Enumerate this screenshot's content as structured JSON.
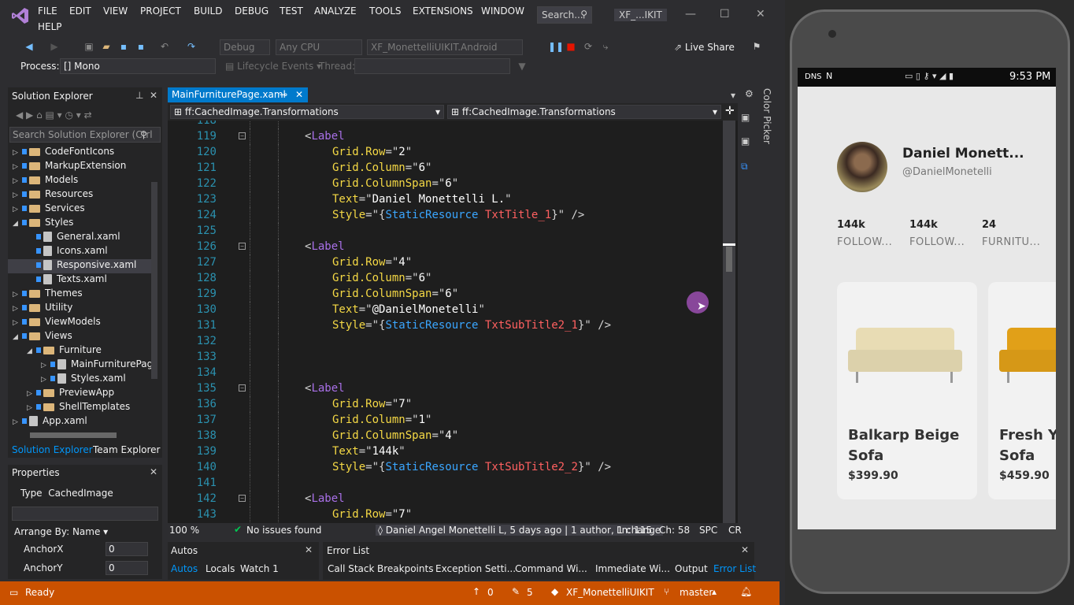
{
  "menubar": {
    "items": [
      "FILE",
      "EDIT",
      "VIEW",
      "PROJECT",
      "BUILD",
      "DEBUG",
      "TEST",
      "ANALYZE",
      "TOOLS",
      "EXTENSIONS",
      "WINDOW",
      "HELP"
    ],
    "search_placeholder": "Search...",
    "window_title": "XF_...IKIT"
  },
  "toolbar": {
    "config": "Debug",
    "platform": "Any CPU",
    "startup": "XF_MonettelliUIKIT.Android",
    "live_share": "Live Share",
    "process_label": "Process:",
    "process_value": "[] Mono",
    "lifecycle": "Lifecycle Events",
    "thread_label": "Thread:"
  },
  "solution_explorer": {
    "title": "Solution Explorer",
    "search_placeholder": "Search Solution Explorer (Ctrl",
    "items": [
      {
        "label": "CodeFontIcons",
        "kind": "folder",
        "indent": 0,
        "arrow": "▷"
      },
      {
        "label": "MarkupExtension",
        "kind": "folder",
        "indent": 0,
        "arrow": "▷"
      },
      {
        "label": "Models",
        "kind": "folder",
        "indent": 0,
        "arrow": "▷"
      },
      {
        "label": "Resources",
        "kind": "folder",
        "indent": 0,
        "arrow": "▷"
      },
      {
        "label": "Services",
        "kind": "folder",
        "indent": 0,
        "arrow": "▷"
      },
      {
        "label": "Styles",
        "kind": "folder",
        "indent": 0,
        "arrow": "◢"
      },
      {
        "label": "General.xaml",
        "kind": "file",
        "indent": 1,
        "arrow": ""
      },
      {
        "label": "Icons.xaml",
        "kind": "file",
        "indent": 1,
        "arrow": ""
      },
      {
        "label": "Responsive.xaml",
        "kind": "file",
        "indent": 1,
        "arrow": "",
        "selected": true
      },
      {
        "label": "Texts.xaml",
        "kind": "file",
        "indent": 1,
        "arrow": ""
      },
      {
        "label": "Themes",
        "kind": "folder",
        "indent": 0,
        "arrow": "▷"
      },
      {
        "label": "Utility",
        "kind": "folder",
        "indent": 0,
        "arrow": "▷"
      },
      {
        "label": "ViewModels",
        "kind": "folder",
        "indent": 0,
        "arrow": "▷"
      },
      {
        "label": "Views",
        "kind": "folder",
        "indent": 0,
        "arrow": "◢"
      },
      {
        "label": "Furniture",
        "kind": "folder",
        "indent": 1,
        "arrow": "◢"
      },
      {
        "label": "MainFurniturePag",
        "kind": "file",
        "indent": 2,
        "arrow": "▷"
      },
      {
        "label": "Styles.xaml",
        "kind": "file",
        "indent": 2,
        "arrow": "▷"
      },
      {
        "label": "PreviewApp",
        "kind": "folder",
        "indent": 1,
        "arrow": "▷"
      },
      {
        "label": "ShellTemplates",
        "kind": "folder",
        "indent": 1,
        "arrow": "▷"
      },
      {
        "label": "App.xaml",
        "kind": "file",
        "indent": 0,
        "arrow": "▷"
      }
    ],
    "tab_active": "Solution Explorer",
    "tab_other": "Team Explorer"
  },
  "properties": {
    "title": "Properties",
    "type_label": "Type",
    "type_value": "CachedImage",
    "arrange_by": "Arrange By: Name",
    "rows": [
      {
        "name": "AnchorX",
        "value": "0"
      },
      {
        "name": "AnchorY",
        "value": "0"
      }
    ]
  },
  "editor": {
    "tab": "MainFurniturePage.xaml",
    "nav_left": "ff:CachedImage.Transformations",
    "nav_right": "ff:CachedImage.Transformations",
    "side_label": "Color Picker",
    "lines": [
      {
        "n": "118",
        "p": []
      },
      {
        "n": "119",
        "p": [
          [
            "<",
            "punc",
            0
          ],
          [
            "Label",
            "tag",
            0
          ]
        ]
      },
      {
        "n": "120",
        "p": [
          [
            "Grid.Row",
            "attr",
            1
          ],
          [
            "=\"",
            "punc",
            0
          ],
          [
            "2",
            "val",
            0
          ],
          [
            "\"",
            "punc",
            0
          ]
        ]
      },
      {
        "n": "121",
        "p": [
          [
            "Grid.Column",
            "attr",
            1
          ],
          [
            "=\"",
            "punc",
            0
          ],
          [
            "6",
            "val",
            0
          ],
          [
            "\"",
            "punc",
            0
          ]
        ]
      },
      {
        "n": "122",
        "p": [
          [
            "Grid.ColumnSpan",
            "attr",
            1
          ],
          [
            "=\"",
            "punc",
            0
          ],
          [
            "6",
            "val",
            0
          ],
          [
            "\"",
            "punc",
            0
          ]
        ]
      },
      {
        "n": "123",
        "p": [
          [
            "Text",
            "attr",
            1
          ],
          [
            "=\"",
            "punc",
            0
          ],
          [
            "Daniel Monettelli L.",
            "val",
            0
          ],
          [
            "\"",
            "punc",
            0
          ]
        ]
      },
      {
        "n": "124",
        "p": [
          [
            "Style",
            "attr",
            1
          ],
          [
            "=\"{",
            "punc",
            0
          ],
          [
            "StaticResource",
            "res",
            0
          ],
          [
            " ",
            "punc",
            0
          ],
          [
            "TxtTitle_1",
            "key",
            0
          ],
          [
            "}\" />",
            "punc",
            0
          ]
        ]
      },
      {
        "n": "125",
        "p": []
      },
      {
        "n": "126",
        "p": [
          [
            "<",
            "punc",
            0
          ],
          [
            "Label",
            "tag",
            0
          ]
        ]
      },
      {
        "n": "127",
        "p": [
          [
            "Grid.Row",
            "attr",
            1
          ],
          [
            "=\"",
            "punc",
            0
          ],
          [
            "4",
            "val",
            0
          ],
          [
            "\"",
            "punc",
            0
          ]
        ]
      },
      {
        "n": "128",
        "p": [
          [
            "Grid.Column",
            "attr",
            1
          ],
          [
            "=\"",
            "punc",
            0
          ],
          [
            "6",
            "val",
            0
          ],
          [
            "\"",
            "punc",
            0
          ]
        ]
      },
      {
        "n": "129",
        "p": [
          [
            "Grid.ColumnSpan",
            "attr",
            1
          ],
          [
            "=\"",
            "punc",
            0
          ],
          [
            "6",
            "val",
            0
          ],
          [
            "\"",
            "punc",
            0
          ]
        ]
      },
      {
        "n": "130",
        "p": [
          [
            "Text",
            "attr",
            1
          ],
          [
            "=\"",
            "punc",
            0
          ],
          [
            "@DanielMonetelli",
            "val",
            0
          ],
          [
            "\"",
            "punc",
            0
          ]
        ]
      },
      {
        "n": "131",
        "p": [
          [
            "Style",
            "attr",
            1
          ],
          [
            "=\"{",
            "punc",
            0
          ],
          [
            "StaticResource",
            "res",
            0
          ],
          [
            " ",
            "punc",
            0
          ],
          [
            "TxtSubTitle2_1",
            "key",
            0
          ],
          [
            "}\" />",
            "punc",
            0
          ]
        ]
      },
      {
        "n": "132",
        "p": []
      },
      {
        "n": "133",
        "p": []
      },
      {
        "n": "134",
        "p": []
      },
      {
        "n": "135",
        "p": [
          [
            "<",
            "punc",
            0
          ],
          [
            "Label",
            "tag",
            0
          ]
        ]
      },
      {
        "n": "136",
        "p": [
          [
            "Grid.Row",
            "attr",
            1
          ],
          [
            "=\"",
            "punc",
            0
          ],
          [
            "7",
            "val",
            0
          ],
          [
            "\"",
            "punc",
            0
          ]
        ]
      },
      {
        "n": "137",
        "p": [
          [
            "Grid.Column",
            "attr",
            1
          ],
          [
            "=\"",
            "punc",
            0
          ],
          [
            "1",
            "val",
            0
          ],
          [
            "\"",
            "punc",
            0
          ]
        ]
      },
      {
        "n": "138",
        "p": [
          [
            "Grid.ColumnSpan",
            "attr",
            1
          ],
          [
            "=\"",
            "punc",
            0
          ],
          [
            "4",
            "val",
            0
          ],
          [
            "\"",
            "punc",
            0
          ]
        ]
      },
      {
        "n": "139",
        "p": [
          [
            "Text",
            "attr",
            1
          ],
          [
            "=\"",
            "punc",
            0
          ],
          [
            "144k",
            "val",
            0
          ],
          [
            "\"",
            "punc",
            0
          ]
        ]
      },
      {
        "n": "140",
        "p": [
          [
            "Style",
            "attr",
            1
          ],
          [
            "=\"{",
            "punc",
            0
          ],
          [
            "StaticResource",
            "res",
            0
          ],
          [
            " ",
            "punc",
            0
          ],
          [
            "TxtSubTitle2_2",
            "key",
            0
          ],
          [
            "}\" />",
            "punc",
            0
          ]
        ]
      },
      {
        "n": "141",
        "p": []
      },
      {
        "n": "142",
        "p": [
          [
            "<",
            "punc",
            0
          ],
          [
            "Label",
            "tag",
            0
          ]
        ]
      },
      {
        "n": "143",
        "p": [
          [
            "Grid.Row",
            "attr",
            1
          ],
          [
            "=\"",
            "punc",
            0
          ],
          [
            "7",
            "val",
            0
          ],
          [
            "\"",
            "punc",
            0
          ]
        ]
      }
    ],
    "status": {
      "zoom": "100 %",
      "issues": "No issues found",
      "blame": "Daniel Angel Monettelli L, 5 days ago | 1 author, 1 change",
      "ln": "Ln: 115",
      "ch": "Ch: 58",
      "spc": "SPC",
      "cr": "CR"
    }
  },
  "bottom_panels": {
    "autos_title": "Autos",
    "autos_tabs": [
      "Autos",
      "Locals",
      "Watch 1"
    ],
    "error_title": "Error List",
    "error_tabs": [
      "Call Stack",
      "Breakpoints",
      "Exception Setti...",
      "Command Wi...",
      "Immediate Wi...",
      "Output",
      "Error List"
    ]
  },
  "statusbar": {
    "ready": "Ready",
    "up_count": "0",
    "edit_count": "5",
    "repo": "XF_MonettelliUIKIT",
    "branch": "master"
  },
  "phone": {
    "status_left": "DNS",
    "time": "9:53 PM",
    "profile_name": "Daniel Monett...",
    "profile_handle": "@DanielMonetelli",
    "stats": [
      {
        "value": "144k",
        "label": "FOLLOW..."
      },
      {
        "value": "144k",
        "label": "FOLLOW..."
      },
      {
        "value": "24",
        "label": "FURNITU..."
      }
    ],
    "cards": [
      {
        "name1": "Balkarp Beige",
        "name2": "Sofa",
        "price": "$399.90"
      },
      {
        "name1": "Fresh Ye",
        "name2": "Sofa",
        "price": "$459.90"
      }
    ]
  }
}
